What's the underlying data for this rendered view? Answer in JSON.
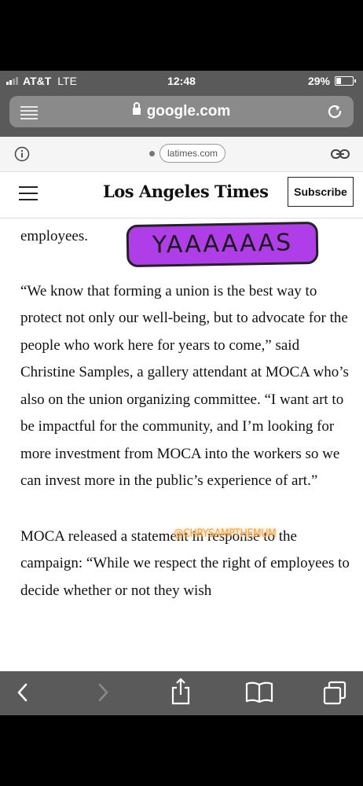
{
  "status": {
    "carrier": "AT&T",
    "network": "LTE",
    "time": "12:48",
    "battery": "29%",
    "battery_level": 0.29
  },
  "browser": {
    "url": "google.com",
    "icons": [
      "reader-icon",
      "lock-icon",
      "reload-icon"
    ]
  },
  "amp": {
    "domain": "latimes.com",
    "icons": [
      "info-icon",
      "link-icon"
    ]
  },
  "site": {
    "masthead": "Los Angeles Times",
    "subscribe_label": "Subscribe"
  },
  "article": {
    "fragment": "employees.",
    "paragraph1": "“We know that forming a union is the best way to protect not only our well-being, but to advocate for the people who work here for years to come,” said Christine Samples, a gallery attendant at MOCA who’s also on the union organizing committee. “I want art to be impactful for the community, and I’m looking for more investment from MOCA into the workers so we can invest more in the public’s experience of art.”",
    "paragraph2": "MOCA released a statement in response to the campaign: “While we respect the right of employees to decide whether or not they wish"
  },
  "stickers": {
    "yas": "YAAAAAAS",
    "handle": "@CHRYSAMPTHEMUM",
    "yas_color": "#b03ee8",
    "handle_color": "#f4a442"
  },
  "toolbar": {
    "icons": [
      "back-icon",
      "forward-icon",
      "share-icon",
      "bookmarks-icon",
      "tabs-icon"
    ]
  }
}
